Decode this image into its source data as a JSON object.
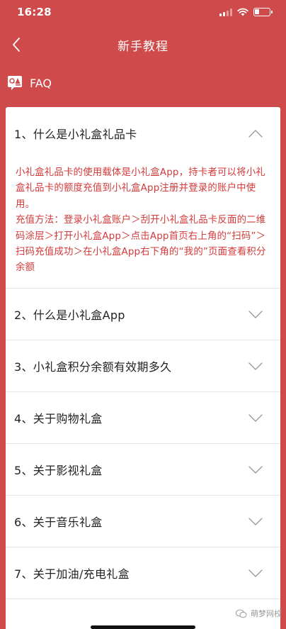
{
  "status": {
    "time": "16:28",
    "battery_level": 0.3
  },
  "header": {
    "title": "新手教程"
  },
  "faq": {
    "label": "FAQ",
    "items": [
      {
        "question": "1、什么是小礼盒礼品卡",
        "expanded": true,
        "answer": [
          "小礼盒礼品卡的使用载体是小礼盒App，持卡者可以将小礼盒礼品卡的额度充值到小礼盒App注册并登录的账户中使用。",
          "充值方法：登录小礼盒账户＞刮开小礼盒礼品卡反面的二维码涂层＞打开小礼盒App＞点击App首页右上角的“扫码”＞扫码充值成功＞在小礼盒App右下角的“我的”页面查看积分余额"
        ]
      },
      {
        "question": "2、什么是小礼盒App",
        "expanded": false
      },
      {
        "question": "3、小礼盒积分余额有效期多久",
        "expanded": false
      },
      {
        "question": "4、关于购物礼盒",
        "expanded": false
      },
      {
        "question": "5、关于影视礼盒",
        "expanded": false
      },
      {
        "question": "6、关于音乐礼盒",
        "expanded": false
      },
      {
        "question": "7、关于加油/充电礼盒",
        "expanded": false
      }
    ]
  },
  "watermark": "萌梦网校",
  "colors": {
    "background": "#cf4a4a",
    "accent": "#d33a3a",
    "card": "#ffffff"
  }
}
